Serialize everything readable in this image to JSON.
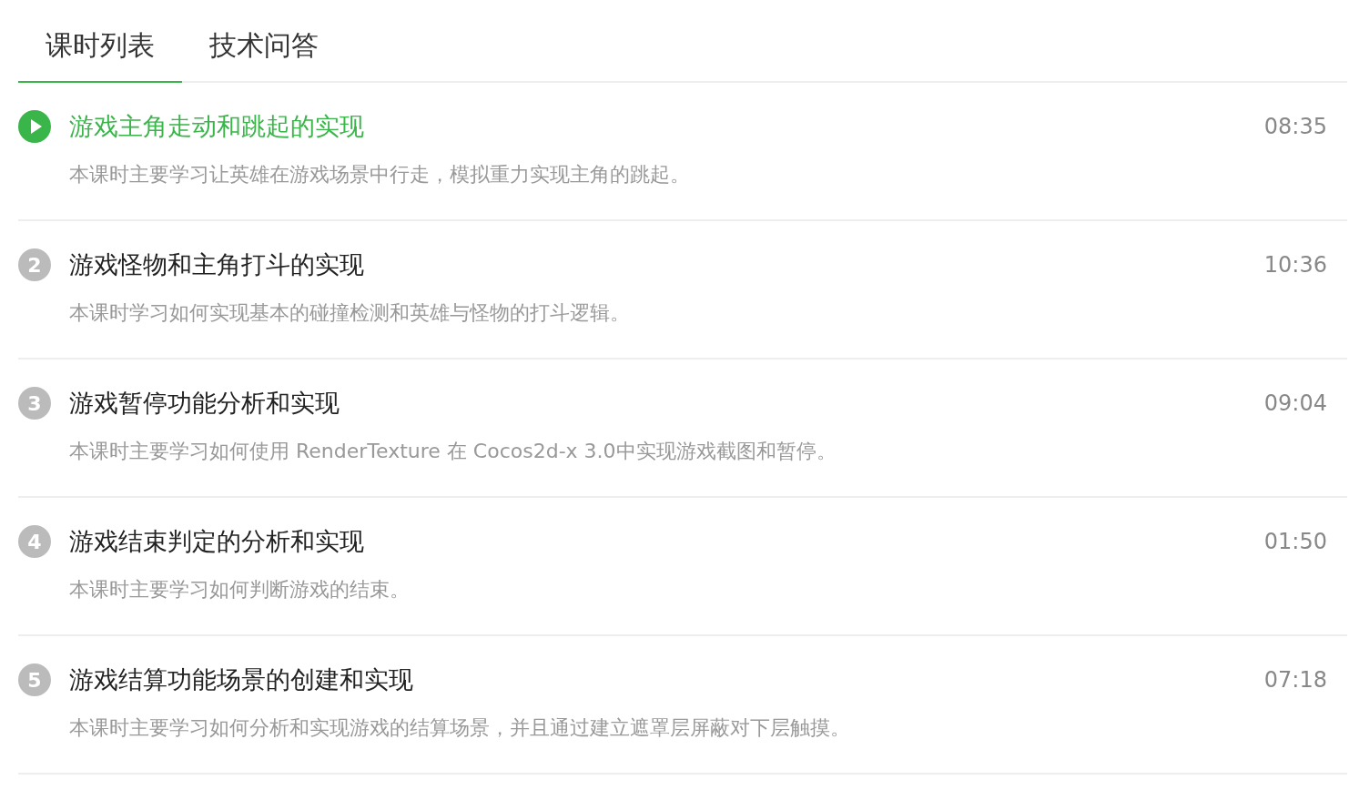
{
  "tabs": [
    {
      "label": "课时列表",
      "selected": true
    },
    {
      "label": "技术问答",
      "selected": false
    }
  ],
  "lessons": [
    {
      "kind": "playing",
      "title": "游戏主角走动和跳起的实现",
      "duration": "08:35",
      "description": "本课时主要学习让英雄在游戏场景中行走，模拟重力实现主角的跳起。"
    },
    {
      "kind": "numbered",
      "number": "2",
      "title": "游戏怪物和主角打斗的实现",
      "duration": "10:36",
      "description": "本课时学习如何实现基本的碰撞检测和英雄与怪物的打斗逻辑。"
    },
    {
      "kind": "numbered",
      "number": "3",
      "title": "游戏暂停功能分析和实现",
      "duration": "09:04",
      "description": "本课时主要学习如何使用 RenderTexture 在 Cocos2d-x 3.0中实现游戏截图和暂停。"
    },
    {
      "kind": "numbered",
      "number": "4",
      "title": "游戏结束判定的分析和实现",
      "duration": "01:50",
      "description": "本课时主要学习如何判断游戏的结束。"
    },
    {
      "kind": "numbered",
      "number": "5",
      "title": "游戏结算功能场景的创建和实现",
      "duration": "07:18",
      "description": "本课时主要学习如何分析和实现游戏的结算场景，并且通过建立遮罩层屏蔽对下层触摸。"
    }
  ]
}
